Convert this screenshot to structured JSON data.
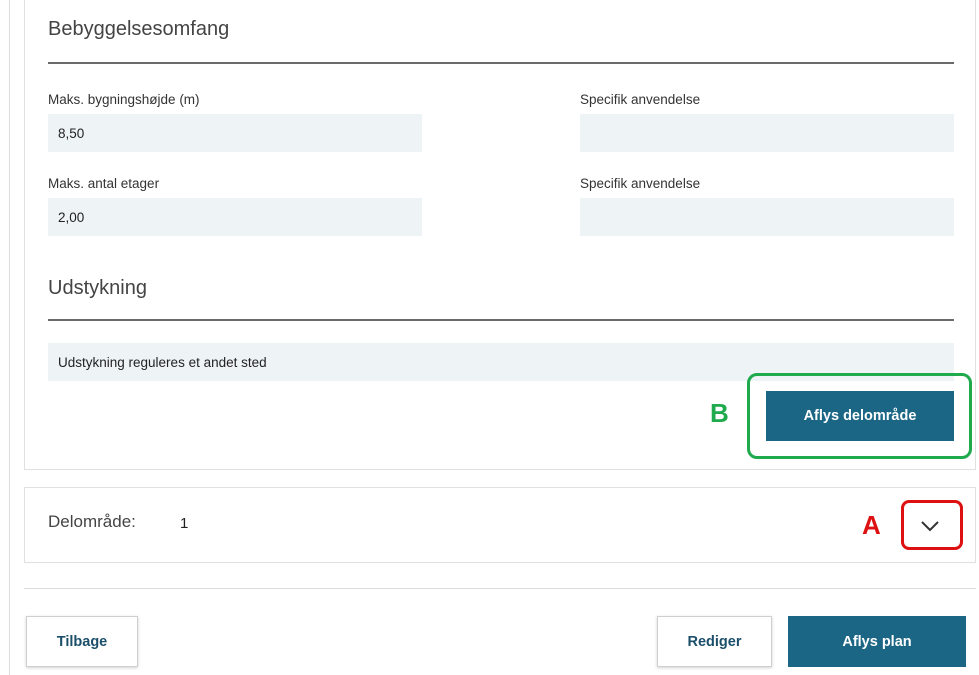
{
  "building_extent": {
    "title": "Bebyggelsesomfang",
    "fields": [
      {
        "label": "Maks. bygningshøjde (m)",
        "value": "8,50"
      },
      {
        "label": "Specifik anvendelse",
        "value": ""
      },
      {
        "label": "Maks. antal etager",
        "value": "2,00"
      },
      {
        "label": "Specifik anvendelse",
        "value": ""
      }
    ]
  },
  "parcelling": {
    "title": "Udstykning",
    "value": "Udstykning reguleres et andet sted"
  },
  "cancel_subarea_label": "Aflys delområde",
  "subarea": {
    "label": "Delområde:",
    "number": "1"
  },
  "markers": {
    "a": "A",
    "b": "B"
  },
  "footer": {
    "back_label": "Tilbage",
    "edit_label": "Rediger",
    "cancel_plan_label": "Aflys plan"
  },
  "icons": {
    "expand": "chevron-down-icon"
  },
  "colors": {
    "primary": "#1b6685",
    "marker_a": "#dd1111",
    "marker_b": "#1eaa4d",
    "field_bg": "#eef3f6"
  }
}
